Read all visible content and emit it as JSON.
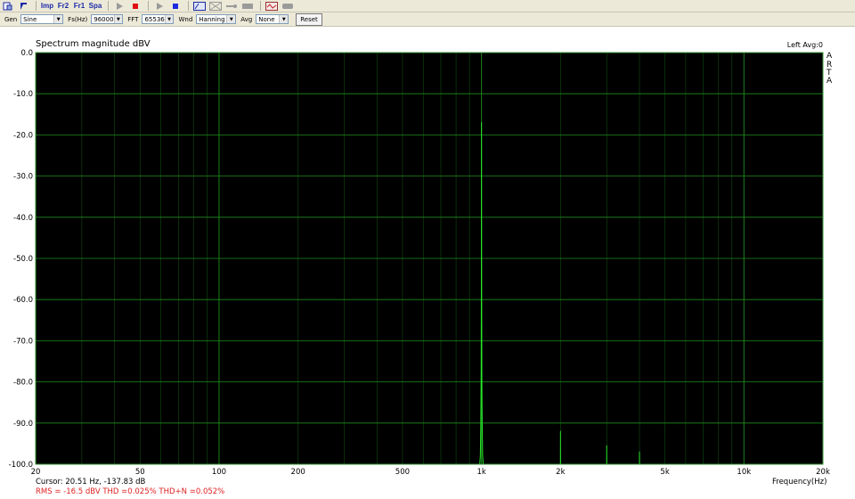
{
  "toolbar": {
    "buttons": [
      {
        "name": "open-file-button",
        "label": ""
      },
      {
        "name": "pointer-button",
        "label": ""
      },
      {
        "name": "imp-mode-button",
        "label": "Imp"
      },
      {
        "name": "fr2-mode-button",
        "label": "Fr2"
      },
      {
        "name": "fr1-mode-button",
        "label": "Fr1"
      },
      {
        "name": "spa-mode-button",
        "label": "Spa"
      },
      {
        "name": "play-gray-button",
        "label": ""
      },
      {
        "name": "record-button",
        "label": ""
      },
      {
        "name": "play-button",
        "label": ""
      },
      {
        "name": "stop-button",
        "label": ""
      },
      {
        "name": "abc-button",
        "label": ""
      },
      {
        "name": "crossed-button",
        "label": ""
      },
      {
        "name": "mic-button",
        "label": ""
      },
      {
        "name": "monitor-button",
        "label": ""
      },
      {
        "name": "scope-button",
        "label": ""
      },
      {
        "name": "pill-button",
        "label": ""
      }
    ]
  },
  "controls": {
    "gen_label": "Gen",
    "gen_value": "Sine",
    "fs_label": "Fs(Hz)",
    "fs_value": "96000",
    "fft_label": "FFT",
    "fft_value": "65536",
    "wnd_label": "Wnd",
    "wnd_value": "Hanning",
    "avg_label": "Avg",
    "avg_value": "None",
    "reset_label": "Reset"
  },
  "graph": {
    "title": "Spectrum magnitude dBV",
    "channel_status": "Left  Avg:0",
    "brand": [
      "A",
      "R",
      "T",
      "A"
    ],
    "cursor_text": "Cursor: 20.51 Hz, -137.83 dB",
    "measurements": "RMS =  -16.5 dBV   THD =0.025%   THD+N =0.052%",
    "colors": {
      "plot_bg": "#000000",
      "grid": "#1e8c1e",
      "trace": "#29e829",
      "meas_text": "#e02020"
    }
  },
  "chart_data": {
    "type": "line",
    "title": "Spectrum magnitude dBV",
    "xlabel": "Frequency(Hz)",
    "ylabel": "",
    "xscale": "log",
    "xlim": [
      20,
      20000
    ],
    "ylim": [
      -100,
      0
    ],
    "grid": true,
    "yticks": [
      0,
      -10,
      -20,
      -30,
      -40,
      -50,
      -60,
      -70,
      -80,
      -90,
      -100
    ],
    "ytick_labels": [
      "0.0",
      "-10.0",
      "-20.0",
      "-30.0",
      "-40.0",
      "-50.0",
      "-60.0",
      "-70.0",
      "-80.0",
      "-90.0",
      "-100.0"
    ],
    "xticks": [
      20,
      50,
      100,
      200,
      500,
      1000,
      2000,
      5000,
      10000,
      20000
    ],
    "xtick_labels": [
      "20",
      "50",
      "100",
      "200",
      "500",
      "1k",
      "2k",
      "5k",
      "10k",
      "20k"
    ],
    "series": [
      {
        "x": [
          20,
          985,
          990,
          994,
          997,
          999,
          1000,
          1001,
          1003,
          1006,
          1010,
          1015,
          1999,
          2000,
          2001,
          2999,
          3000,
          3001,
          3999,
          4000,
          4001,
          20000
        ],
        "y": [
          -100,
          -100,
          -98,
          -90,
          -78,
          -56,
          -17,
          -56,
          -78,
          -90,
          -98,
          -100,
          -100,
          -92,
          -100,
          -100,
          -95.5,
          -100,
          -100,
          -97,
          -100,
          -100
        ]
      }
    ]
  }
}
